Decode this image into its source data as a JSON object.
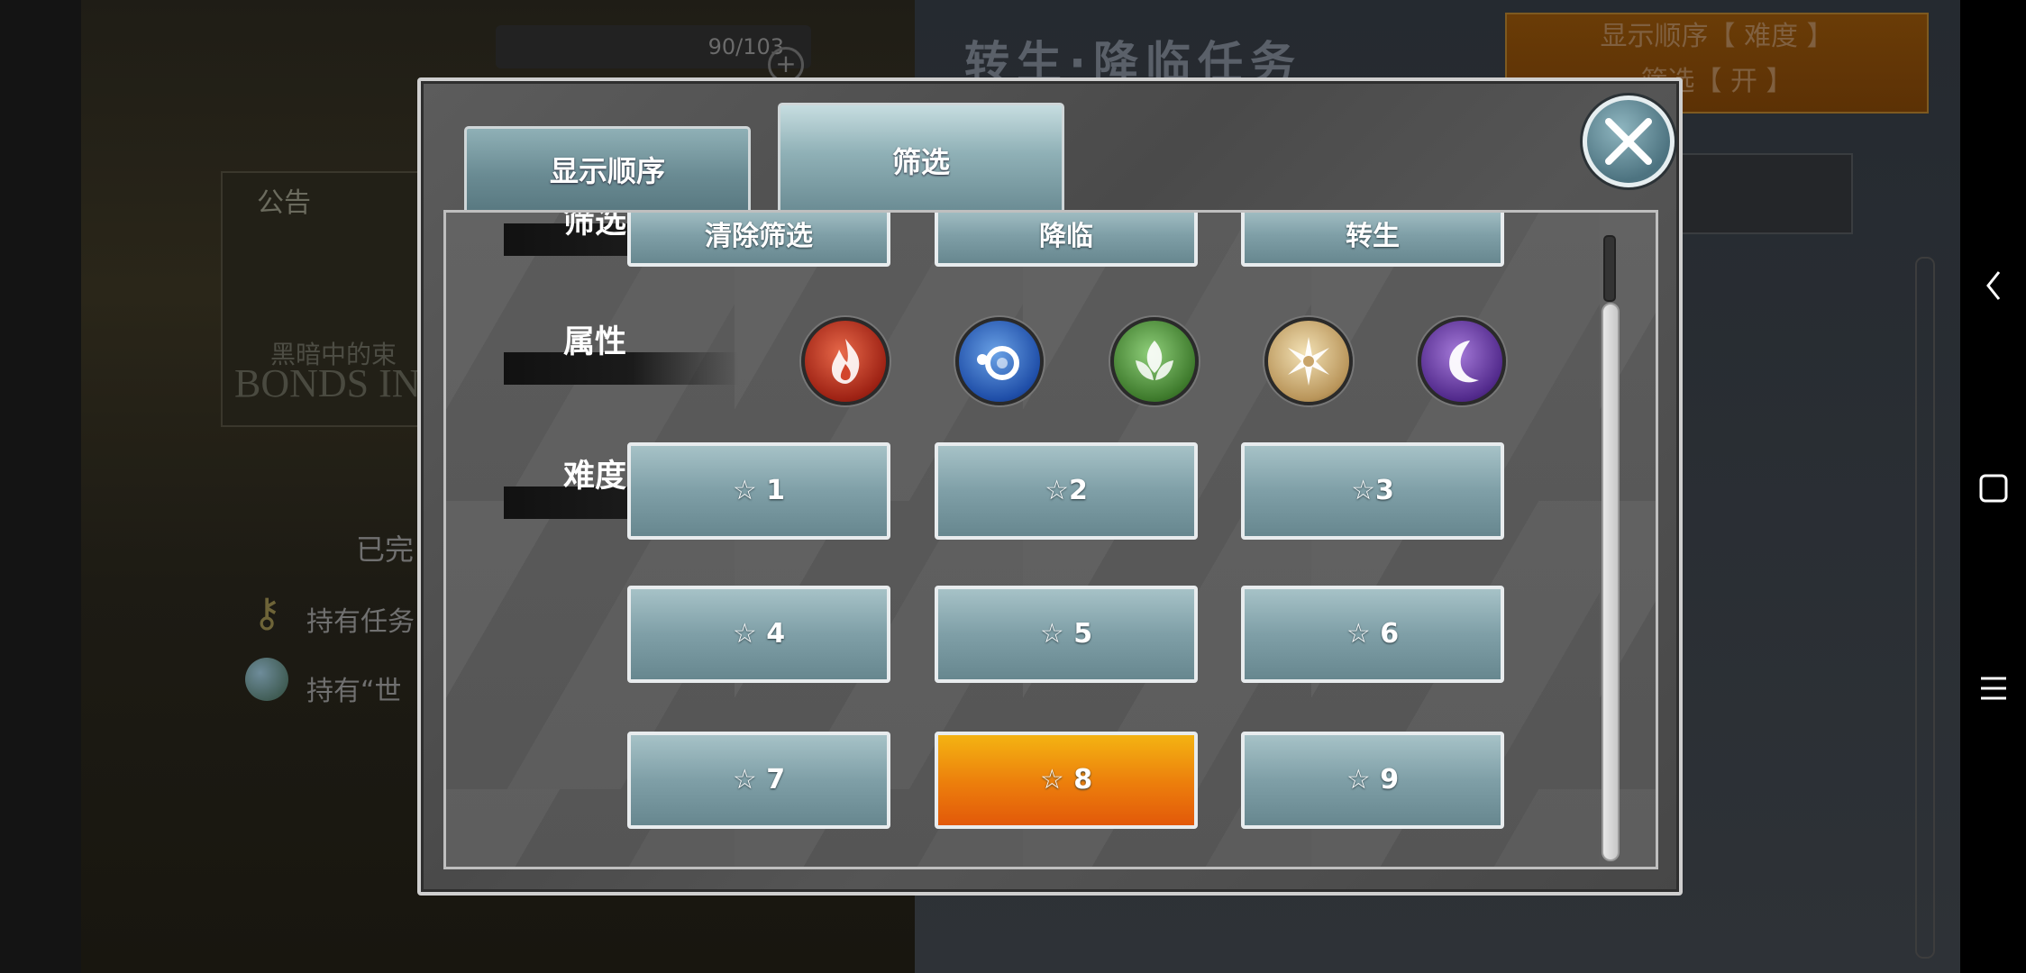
{
  "background": {
    "counter": "90/103",
    "title": "转生·降临任务",
    "order_button_line1": "显示顺序【 难度 】",
    "order_button_line2": "筛选【 开 】",
    "notice_label": "公告",
    "notice_banner_cn": "黑暗中的束",
    "notice_banner_en": "BONDS IN T",
    "completed_text": "已完",
    "hold_task_text": "持有任务",
    "hold_world_text": "持有“世"
  },
  "modal": {
    "tabs": {
      "order_label": "显示顺序",
      "filter_label": "筛选"
    },
    "rows": {
      "filter_label": "筛选",
      "attribute_label": "属性",
      "difficulty_label": "难度"
    },
    "filter_buttons": [
      "清除筛选",
      "降临",
      "转生"
    ],
    "attributes": [
      "fire-icon",
      "water-icon",
      "wood-icon",
      "light-icon",
      "dark-icon"
    ],
    "difficulty_buttons": [
      "☆ 1",
      "☆2",
      "☆3",
      "☆ 4",
      "☆ 5",
      "☆ 6",
      "☆ 7",
      "☆ 8",
      "☆ 9"
    ],
    "selected_difficulty": "☆ 8",
    "colors": {
      "button_teal": "#7f9fa7",
      "selected_orange": "#ec7d0c"
    }
  },
  "navbar": {
    "icons": [
      "back-icon",
      "home-icon",
      "menu-icon"
    ]
  }
}
